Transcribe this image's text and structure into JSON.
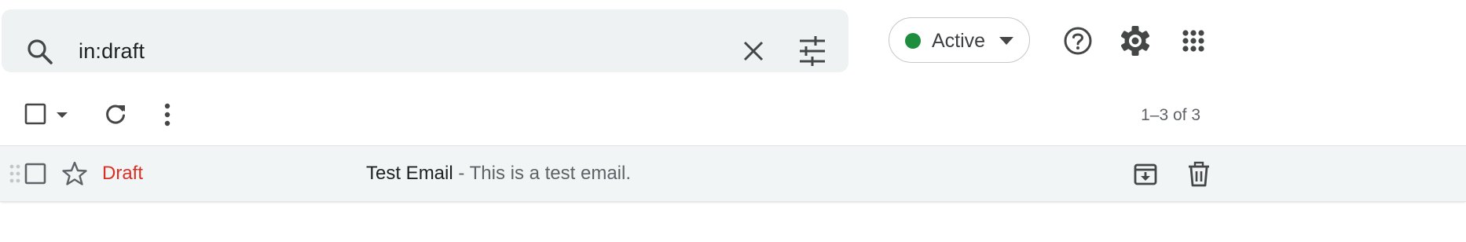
{
  "search": {
    "query": "in:draft",
    "icon": "search-icon",
    "clear_icon": "close-icon",
    "options_icon": "tune-icon"
  },
  "status": {
    "label": "Active",
    "color": "#1e8e3e"
  },
  "header_icons": [
    "help-icon",
    "gear-icon",
    "apps-grid-icon"
  ],
  "toolbar": {
    "pager_text": "1–3 of 3"
  },
  "emails": [
    {
      "sender": "Draft",
      "sender_color": "#d93025",
      "subject": "Test Email",
      "snippet": " - This is a test email."
    }
  ]
}
